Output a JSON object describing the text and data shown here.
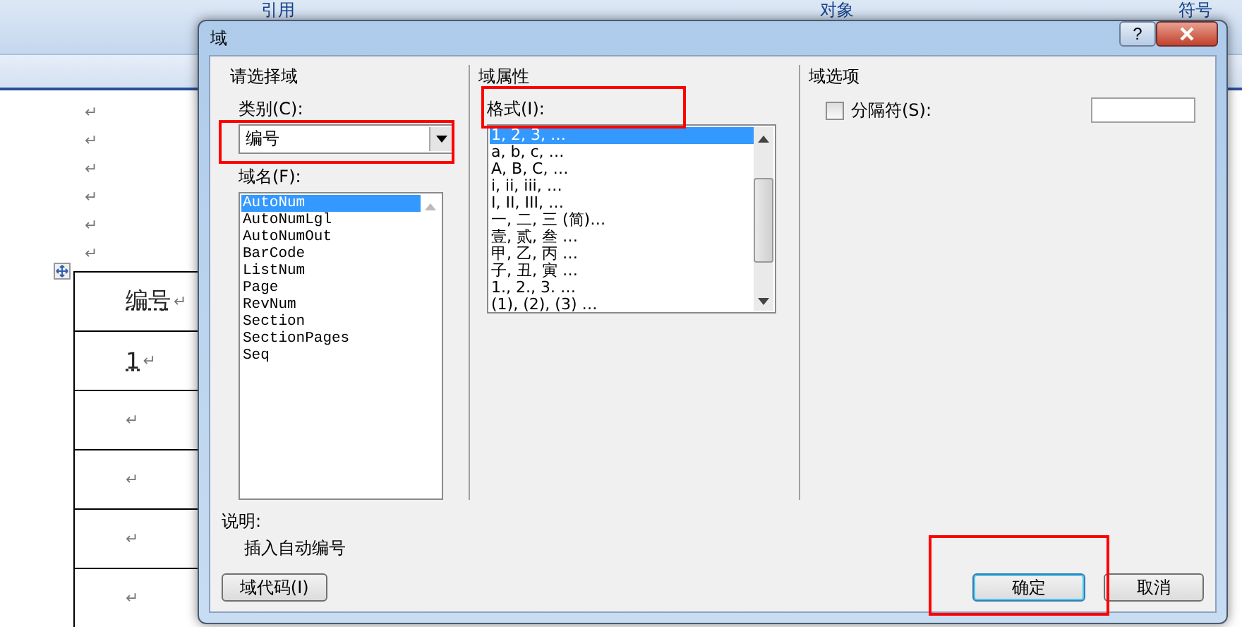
{
  "ribbon": {
    "labels": [
      "引用",
      "对象",
      "符号"
    ]
  },
  "document": {
    "paragraph_marks": [
      "↵",
      "↵",
      "↵",
      "↵",
      "↵",
      "↵"
    ],
    "table_rows": [
      {
        "text": "编号",
        "mark": "↵"
      },
      {
        "text": "1",
        "mark": "↵"
      },
      {
        "mark": "↵"
      },
      {
        "mark": "↵"
      },
      {
        "mark": "↵"
      },
      {
        "mark": "↵"
      }
    ]
  },
  "dialog": {
    "title": "域",
    "help": "?",
    "choose_field": {
      "title": "请选择域",
      "category_label": "类别(C):",
      "category_value": "编号",
      "names_label": "域名(F):",
      "names": [
        {
          "label": "AutoNum",
          "selected": true
        },
        {
          "label": "AutoNumLgl",
          "selected": false
        },
        {
          "label": "AutoNumOut",
          "selected": false
        },
        {
          "label": "BarCode",
          "selected": false
        },
        {
          "label": "ListNum",
          "selected": false
        },
        {
          "label": "Page",
          "selected": false
        },
        {
          "label": "RevNum",
          "selected": false
        },
        {
          "label": "Section",
          "selected": false
        },
        {
          "label": "SectionPages",
          "selected": false
        },
        {
          "label": "Seq",
          "selected": false
        }
      ]
    },
    "properties": {
      "title": "域属性",
      "format_label": "格式(I):",
      "formats": [
        {
          "label": "1, 2, 3, …",
          "selected": true
        },
        {
          "label": "a, b, c, …",
          "selected": false
        },
        {
          "label": "A, B, C, …",
          "selected": false
        },
        {
          "label": "i, ii, iii, …",
          "selected": false
        },
        {
          "label": "I, II, III, …",
          "selected": false
        },
        {
          "label": "一, 二, 三 (简)…",
          "selected": false
        },
        {
          "label": "壹, 贰, 叁 …",
          "selected": false
        },
        {
          "label": "甲, 乙, 丙 …",
          "selected": false
        },
        {
          "label": "子, 丑, 寅 …",
          "selected": false
        },
        {
          "label": "1., 2., 3. …",
          "selected": false
        },
        {
          "label": "(1), (2), (3) …",
          "selected": false
        }
      ]
    },
    "options": {
      "title": "域选项",
      "separator_label": "分隔符(S):",
      "separator_checked": false
    },
    "description_label": "说明:",
    "description": "插入自动编号",
    "buttons": [
      {
        "label": "域代码(I)",
        "default": false
      },
      {
        "label": "确定",
        "default": true
      },
      {
        "label": "取消",
        "default": false
      }
    ]
  },
  "annotation_frames": [
    {
      "kind": "frame"
    },
    {
      "kind": "frame"
    },
    {
      "kind": "frame"
    }
  ]
}
